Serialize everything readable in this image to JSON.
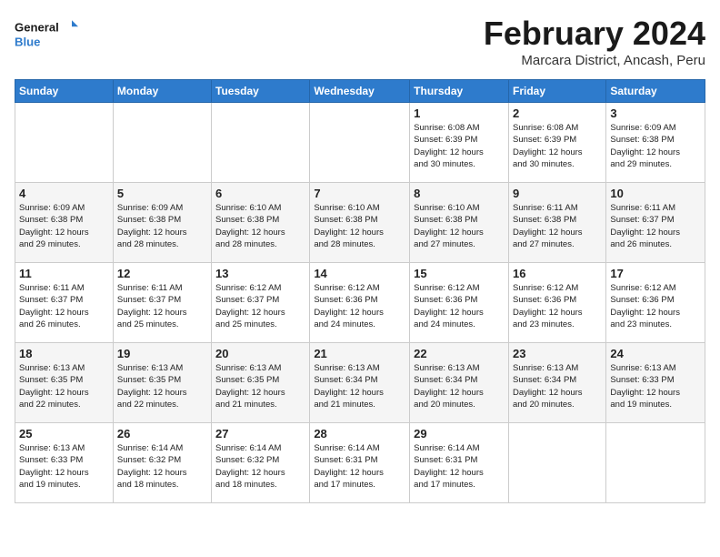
{
  "logo": {
    "line1": "General",
    "line2": "Blue"
  },
  "title": "February 2024",
  "subtitle": "Marcara District, Ancash, Peru",
  "weekdays": [
    "Sunday",
    "Monday",
    "Tuesday",
    "Wednesday",
    "Thursday",
    "Friday",
    "Saturday"
  ],
  "weeks": [
    [
      {
        "day": "",
        "info": ""
      },
      {
        "day": "",
        "info": ""
      },
      {
        "day": "",
        "info": ""
      },
      {
        "day": "",
        "info": ""
      },
      {
        "day": "1",
        "info": "Sunrise: 6:08 AM\nSunset: 6:39 PM\nDaylight: 12 hours\nand 30 minutes."
      },
      {
        "day": "2",
        "info": "Sunrise: 6:08 AM\nSunset: 6:39 PM\nDaylight: 12 hours\nand 30 minutes."
      },
      {
        "day": "3",
        "info": "Sunrise: 6:09 AM\nSunset: 6:38 PM\nDaylight: 12 hours\nand 29 minutes."
      }
    ],
    [
      {
        "day": "4",
        "info": "Sunrise: 6:09 AM\nSunset: 6:38 PM\nDaylight: 12 hours\nand 29 minutes."
      },
      {
        "day": "5",
        "info": "Sunrise: 6:09 AM\nSunset: 6:38 PM\nDaylight: 12 hours\nand 28 minutes."
      },
      {
        "day": "6",
        "info": "Sunrise: 6:10 AM\nSunset: 6:38 PM\nDaylight: 12 hours\nand 28 minutes."
      },
      {
        "day": "7",
        "info": "Sunrise: 6:10 AM\nSunset: 6:38 PM\nDaylight: 12 hours\nand 28 minutes."
      },
      {
        "day": "8",
        "info": "Sunrise: 6:10 AM\nSunset: 6:38 PM\nDaylight: 12 hours\nand 27 minutes."
      },
      {
        "day": "9",
        "info": "Sunrise: 6:11 AM\nSunset: 6:38 PM\nDaylight: 12 hours\nand 27 minutes."
      },
      {
        "day": "10",
        "info": "Sunrise: 6:11 AM\nSunset: 6:37 PM\nDaylight: 12 hours\nand 26 minutes."
      }
    ],
    [
      {
        "day": "11",
        "info": "Sunrise: 6:11 AM\nSunset: 6:37 PM\nDaylight: 12 hours\nand 26 minutes."
      },
      {
        "day": "12",
        "info": "Sunrise: 6:11 AM\nSunset: 6:37 PM\nDaylight: 12 hours\nand 25 minutes."
      },
      {
        "day": "13",
        "info": "Sunrise: 6:12 AM\nSunset: 6:37 PM\nDaylight: 12 hours\nand 25 minutes."
      },
      {
        "day": "14",
        "info": "Sunrise: 6:12 AM\nSunset: 6:36 PM\nDaylight: 12 hours\nand 24 minutes."
      },
      {
        "day": "15",
        "info": "Sunrise: 6:12 AM\nSunset: 6:36 PM\nDaylight: 12 hours\nand 24 minutes."
      },
      {
        "day": "16",
        "info": "Sunrise: 6:12 AM\nSunset: 6:36 PM\nDaylight: 12 hours\nand 23 minutes."
      },
      {
        "day": "17",
        "info": "Sunrise: 6:12 AM\nSunset: 6:36 PM\nDaylight: 12 hours\nand 23 minutes."
      }
    ],
    [
      {
        "day": "18",
        "info": "Sunrise: 6:13 AM\nSunset: 6:35 PM\nDaylight: 12 hours\nand 22 minutes."
      },
      {
        "day": "19",
        "info": "Sunrise: 6:13 AM\nSunset: 6:35 PM\nDaylight: 12 hours\nand 22 minutes."
      },
      {
        "day": "20",
        "info": "Sunrise: 6:13 AM\nSunset: 6:35 PM\nDaylight: 12 hours\nand 21 minutes."
      },
      {
        "day": "21",
        "info": "Sunrise: 6:13 AM\nSunset: 6:34 PM\nDaylight: 12 hours\nand 21 minutes."
      },
      {
        "day": "22",
        "info": "Sunrise: 6:13 AM\nSunset: 6:34 PM\nDaylight: 12 hours\nand 20 minutes."
      },
      {
        "day": "23",
        "info": "Sunrise: 6:13 AM\nSunset: 6:34 PM\nDaylight: 12 hours\nand 20 minutes."
      },
      {
        "day": "24",
        "info": "Sunrise: 6:13 AM\nSunset: 6:33 PM\nDaylight: 12 hours\nand 19 minutes."
      }
    ],
    [
      {
        "day": "25",
        "info": "Sunrise: 6:13 AM\nSunset: 6:33 PM\nDaylight: 12 hours\nand 19 minutes."
      },
      {
        "day": "26",
        "info": "Sunrise: 6:14 AM\nSunset: 6:32 PM\nDaylight: 12 hours\nand 18 minutes."
      },
      {
        "day": "27",
        "info": "Sunrise: 6:14 AM\nSunset: 6:32 PM\nDaylight: 12 hours\nand 18 minutes."
      },
      {
        "day": "28",
        "info": "Sunrise: 6:14 AM\nSunset: 6:31 PM\nDaylight: 12 hours\nand 17 minutes."
      },
      {
        "day": "29",
        "info": "Sunrise: 6:14 AM\nSunset: 6:31 PM\nDaylight: 12 hours\nand 17 minutes."
      },
      {
        "day": "",
        "info": ""
      },
      {
        "day": "",
        "info": ""
      }
    ]
  ]
}
